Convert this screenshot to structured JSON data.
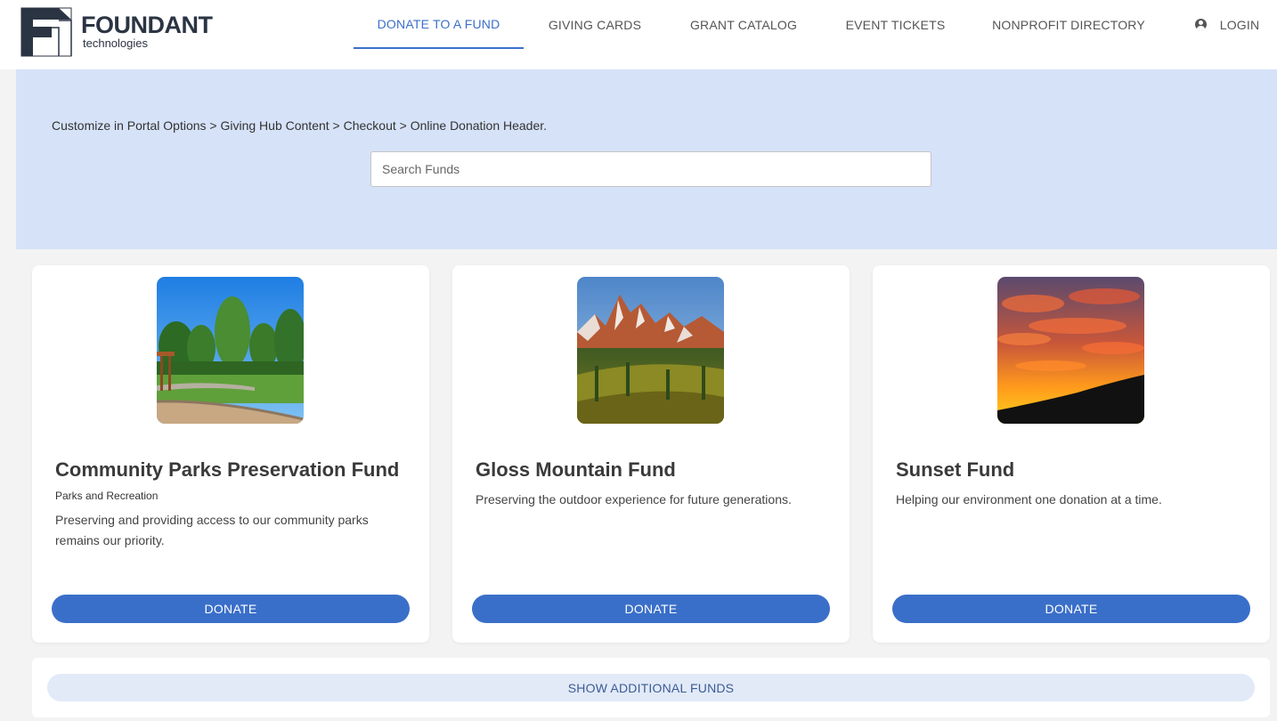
{
  "brand": {
    "name": "FOUNDANT",
    "sub": "technologies"
  },
  "nav": {
    "donate": "DONATE TO A FUND",
    "giving_cards": "GIVING CARDS",
    "grant_catalog": "GRANT CATALOG",
    "event_tickets": "EVENT TICKETS",
    "nonprofit_directory": "NONPROFIT DIRECTORY",
    "login": "LOGIN",
    "active": "DONATE TO A FUND"
  },
  "hero": {
    "text": "Customize in Portal Options > Giving Hub Content > Checkout > Online Donation Header.",
    "search_placeholder": "Search Funds"
  },
  "funds": [
    {
      "title": "Community Parks Preservation Fund",
      "category": "Parks and Recreation",
      "description": "Preserving and providing access to our community parks remains our priority.",
      "button": "DONATE",
      "image": "park-photo"
    },
    {
      "title": "Gloss Mountain Fund",
      "category": "",
      "description": "Preserving the outdoor experience for future generations.",
      "button": "DONATE",
      "image": "mountain-photo"
    },
    {
      "title": "Sunset Fund",
      "category": "",
      "description": "Helping our environment one donation at a time.",
      "button": "DONATE",
      "image": "sunset-photo"
    }
  ],
  "more_button": "SHOW ADDITIONAL FUNDS",
  "colors": {
    "accent": "#3a6fc9",
    "hero_bg": "#d6e2f8",
    "page_bg": "#f3f3f3",
    "brand_dark": "#2b3443"
  }
}
